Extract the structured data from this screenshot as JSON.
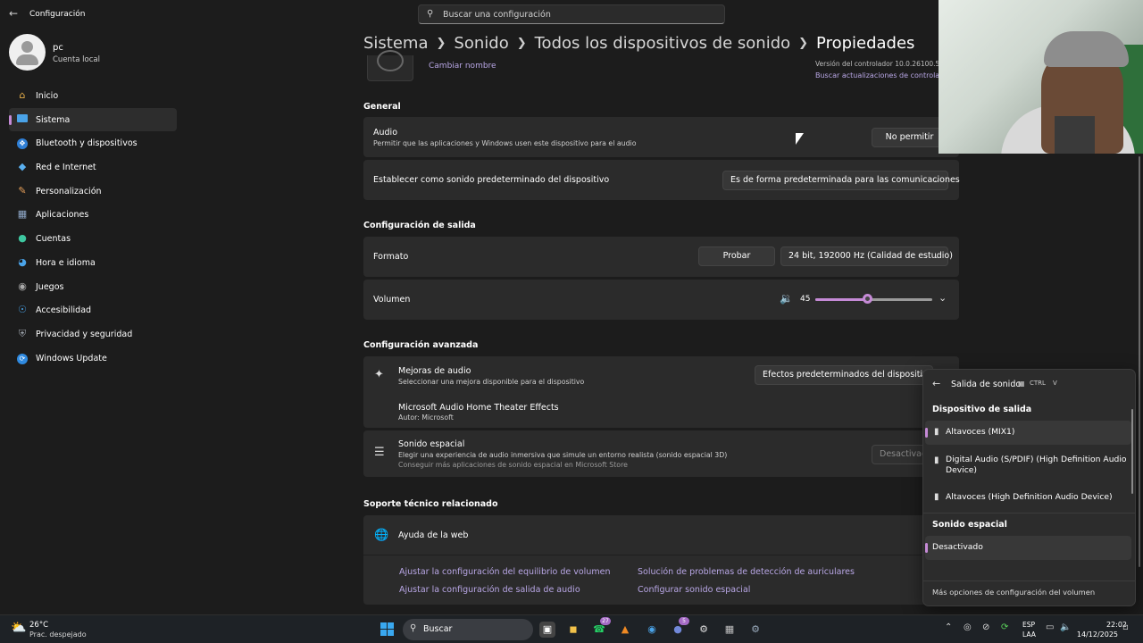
{
  "window": {
    "title": "Configuración"
  },
  "search": {
    "placeholder": "Buscar una configuración"
  },
  "profile": {
    "name": "pc",
    "type": "Cuenta local"
  },
  "sidebar": {
    "items": [
      {
        "label": "Inicio",
        "icon": "home-icon"
      },
      {
        "label": "Sistema",
        "icon": "system-icon",
        "active": true
      },
      {
        "label": "Bluetooth y dispositivos",
        "icon": "bluetooth-icon"
      },
      {
        "label": "Red e Internet",
        "icon": "wifi-icon"
      },
      {
        "label": "Personalización",
        "icon": "brush-icon"
      },
      {
        "label": "Aplicaciones",
        "icon": "apps-icon"
      },
      {
        "label": "Cuentas",
        "icon": "account-icon"
      },
      {
        "label": "Hora e idioma",
        "icon": "globe-clock-icon"
      },
      {
        "label": "Juegos",
        "icon": "gamepad-icon"
      },
      {
        "label": "Accesibilidad",
        "icon": "accessibility-icon"
      },
      {
        "label": "Privacidad y seguridad",
        "icon": "shield-icon"
      },
      {
        "label": "Windows Update",
        "icon": "update-icon"
      }
    ]
  },
  "breadcrumb": {
    "items": [
      "Sistema",
      "Sonido",
      "Todos los dispositivos de sonido"
    ],
    "current": "Propiedades"
  },
  "device": {
    "rename": "Cambiar nombre",
    "driver_version": "Versión del controlador 10.0.26100.5",
    "driver_update": "Buscar actualizaciones de controlador"
  },
  "general": {
    "title": "General",
    "audio_title": "Audio",
    "audio_desc": "Permitir que las aplicaciones y Windows usen este dispositivo para el audio",
    "audio_button": "No permitir",
    "default_title": "Establecer como sonido predeterminado del dispositivo",
    "default_value": "Es de forma predeterminada para las comunicaciones"
  },
  "output": {
    "title": "Configuración de salida",
    "format_label": "Formato",
    "test_button": "Probar",
    "format_value": "24 bit, 192000 Hz (Calidad de estudio)",
    "volume_label": "Volumen",
    "volume_value": "45",
    "volume_level": 0.45
  },
  "advanced": {
    "title": "Configuración avanzada",
    "enh_title": "Mejoras de audio",
    "enh_desc": "Seleccionar una mejora disponible para el dispositivo",
    "enh_value": "Efectos predeterminados del dispositivo",
    "theater_title": "Microsoft Audio Home Theater Effects",
    "theater_author": "Autor: Microsoft",
    "spatial_title": "Sonido espacial",
    "spatial_desc": "Elegir una experiencia de audio inmersiva que simule un entorno realista (sonido espacial 3D)",
    "spatial_link": "Conseguir más aplicaciones de sonido espacial en Microsoft Store",
    "spatial_value": "Desactivado"
  },
  "support": {
    "title": "Soporte técnico relacionado",
    "help_title": "Ayuda de la web",
    "links": [
      "Ajustar la configuración del equilibrio de volumen",
      "Solución de problemas de detección de auriculares",
      "Ajustar la configuración de salida de audio",
      "Configurar sonido espacial"
    ]
  },
  "flyout": {
    "title": "Salida de sonido",
    "shortcut_mod": "CTRL",
    "shortcut_key": "V",
    "devices_title": "Dispositivo de salida",
    "devices": [
      "Altavoces (MIX1)",
      "Digital Audio (S/PDIF) (High Definition Audio Device)",
      "Altavoces (High Definition Audio Device)"
    ],
    "spatial_title": "Sonido espacial",
    "spatial_value": "Desactivado",
    "more": "Más opciones de configuración del volumen"
  },
  "taskbar": {
    "temp": "26°C",
    "condition": "Prac. despejado",
    "search": "Buscar",
    "badge_a": "27",
    "badge_b": "5",
    "lang1": "ESP",
    "lang2": "LAA",
    "time": "22:02",
    "date": "14/12/2025"
  },
  "colors": {
    "accent": "#c58ad6",
    "link": "#b9a7e6",
    "background": "#1c1c1c",
    "card": "#2b2b2b"
  }
}
